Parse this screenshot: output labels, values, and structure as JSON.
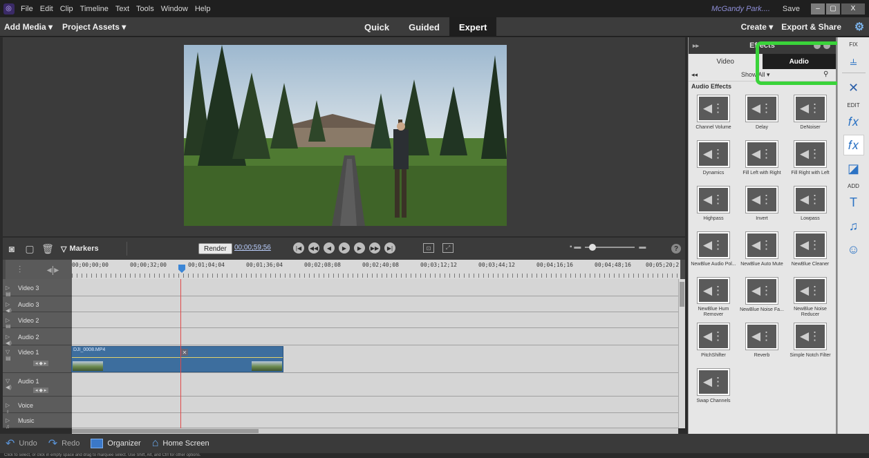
{
  "menubar": {
    "app_icon": "elements-app-icon",
    "items": [
      "File",
      "Edit",
      "Clip",
      "Timeline",
      "Text",
      "Tools",
      "Window",
      "Help"
    ],
    "user": "McGandy Park....",
    "save": "Save",
    "minimize": "–",
    "restore": "▢",
    "close": "X"
  },
  "topbar": {
    "add_media": "Add Media ▾",
    "project_assets": "Project Assets ▾",
    "modes": [
      "Quick",
      "Guided",
      "Expert"
    ],
    "active_mode": "Expert",
    "create": "Create ▾",
    "export_share": "Export & Share"
  },
  "timeline": {
    "markers": "Markers",
    "render": "Render",
    "timecode": "00;00;59;56",
    "ruler_ticks": [
      "00;00;00;00",
      "00;00;32;00",
      "00;01;04;04",
      "00;01;36;04",
      "00;02;08;08",
      "00;02;40;08",
      "00;03;12;12",
      "00;03;44;12",
      "00;04;16;16",
      "00;04;48;16",
      "00;05;20;2"
    ],
    "tracks": [
      {
        "name": "Video 3",
        "type": "video"
      },
      {
        "name": "Audio 3",
        "type": "audio"
      },
      {
        "name": "Video 2",
        "type": "video"
      },
      {
        "name": "Audio 2",
        "type": "audio"
      },
      {
        "name": "Video 1",
        "type": "video"
      },
      {
        "name": "Audio 1",
        "type": "audio"
      },
      {
        "name": "Voice",
        "type": "voice"
      },
      {
        "name": "Music",
        "type": "music"
      }
    ],
    "clip_name": "DJI_0008.MP4"
  },
  "effects_panel": {
    "title": "Effects",
    "tabs": [
      "Video",
      "Audio"
    ],
    "active_tab": "Audio",
    "filter": "Show All ▾",
    "section": "Audio Effects",
    "effects": [
      "Channel Volume",
      "Delay",
      "DeNoiser",
      "Dynamics",
      "Fill Left with Right",
      "Fill Right with Left",
      "Highpass",
      "Invert",
      "Lowpass",
      "NewBlue Audio Pol...",
      "NewBlue Auto Mute",
      "NewBlue Cleaner",
      "NewBlue Hum Remover",
      "NewBlue Noise Fa...",
      "NewBlue Noise Reducer",
      "PitchShifter",
      "Reverb",
      "Simple Notch Filter",
      "Swap Channels"
    ],
    "highlight_color": "#3ad33a"
  },
  "right_tools": {
    "fix": "FIX",
    "edit": "EDIT",
    "add": "ADD"
  },
  "bottombar": {
    "undo": "Undo",
    "redo": "Redo",
    "organizer": "Organizer",
    "home_screen": "Home Screen"
  },
  "status": "Click to select, or click in empty space and drag to marquee select. Use Shift, Alt, and Ctrl for other options."
}
